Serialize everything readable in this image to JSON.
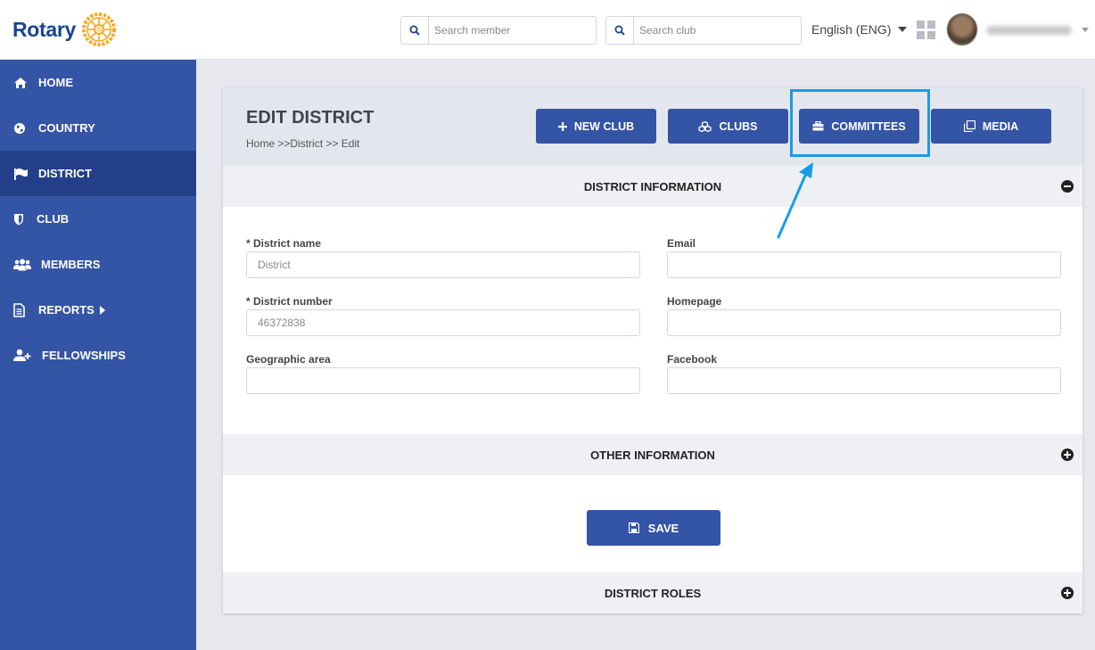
{
  "header": {
    "logo_text": "Rotary",
    "search_member_placeholder": "Search member",
    "search_club_placeholder": "Search club",
    "language": "English (ENG)"
  },
  "sidebar": {
    "items": [
      {
        "label": "HOME",
        "icon": "home-icon"
      },
      {
        "label": "COUNTRY",
        "icon": "globe-icon"
      },
      {
        "label": "DISTRICT",
        "icon": "flag-icon",
        "active": true
      },
      {
        "label": "CLUB",
        "icon": "shield-icon"
      },
      {
        "label": "MEMBERS",
        "icon": "users-icon"
      },
      {
        "label": "REPORTS",
        "icon": "document-icon",
        "has_submenu": true
      },
      {
        "label": "FELLOWSHIPS",
        "icon": "user-plus-icon"
      }
    ]
  },
  "page": {
    "title": "EDIT DISTRICT",
    "breadcrumb": "Home >>District >> Edit"
  },
  "actions": {
    "new_club": "NEW CLUB",
    "clubs": "CLUBS",
    "committees": "COMMITTEES",
    "media": "MEDIA"
  },
  "sections": {
    "district_information": "DISTRICT INFORMATION",
    "other_information": "OTHER INFORMATION",
    "district_roles": "DISTRICT ROLES"
  },
  "form": {
    "district_name_label": "* District name",
    "district_name_placeholder": "District",
    "email_label": "Email",
    "district_number_label": "* District number",
    "district_number_placeholder": "46372838",
    "homepage_label": "Homepage",
    "geographic_area_label": "Geographic area",
    "facebook_label": "Facebook"
  },
  "save_label": "SAVE",
  "colors": {
    "primary": "#3454a6",
    "sidebar_active": "#243f8a",
    "highlight": "#1a9be8",
    "logo_gold": "#f7a81b"
  }
}
